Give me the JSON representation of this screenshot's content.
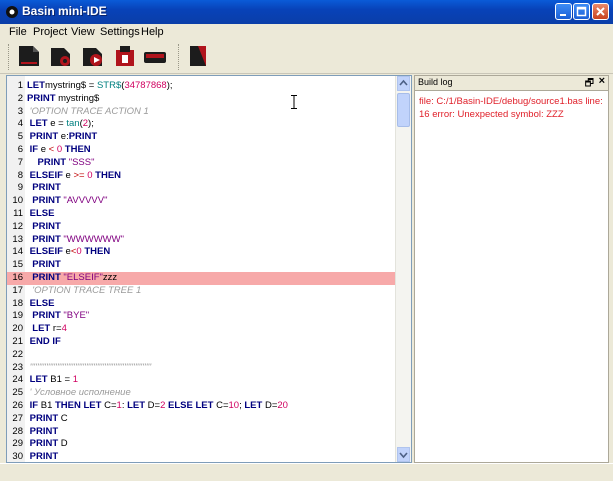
{
  "window": {
    "title": "Basin mini-IDE"
  },
  "menu": [
    "File",
    "Project",
    "View",
    "Settings",
    "Help"
  ],
  "toolbar": {
    "buttons": [
      {
        "name": "new-file-icon",
        "color": "#b0141c"
      },
      {
        "name": "open-project-icon",
        "color": "#b0141c"
      },
      {
        "name": "run-icon",
        "color": "#b0141c"
      },
      {
        "name": "build-icon",
        "color": "#b0141c"
      },
      {
        "name": "stop-icon",
        "color": "#b0141c"
      },
      {
        "name": "settings-icon",
        "color": "#b0141c"
      }
    ]
  },
  "editor": {
    "highlighted_line": 16,
    "lines": [
      {
        "n": "1",
        "t": [
          [
            "kw",
            "LET"
          ],
          [
            "",
            "mystring$ = "
          ],
          [
            "fn",
            "STR$"
          ],
          [
            "",
            "("
          ],
          [
            "num",
            "34787868"
          ],
          [
            "",
            ");"
          ]
        ]
      },
      {
        "n": "2",
        "t": [
          [
            "kw",
            "PRINT"
          ],
          [
            "",
            " mystring$"
          ]
        ]
      },
      {
        "n": "3",
        "t": [
          [
            "cmt",
            " 'OPTION TRACE ACTION 1"
          ]
        ]
      },
      {
        "n": "4",
        "t": [
          [
            "kw",
            " LET"
          ],
          [
            "",
            " e = "
          ],
          [
            "fn",
            "tan"
          ],
          [
            "",
            "("
          ],
          [
            "num",
            "2"
          ],
          [
            "",
            ");"
          ]
        ]
      },
      {
        "n": "5",
        "t": [
          [
            "kw",
            " PRINT"
          ],
          [
            "",
            " e:"
          ],
          [
            "kw",
            "PRINT"
          ]
        ]
      },
      {
        "n": "6",
        "t": [
          [
            "kw",
            " IF"
          ],
          [
            "",
            " e "
          ],
          [
            "op",
            "<"
          ],
          [
            "",
            " "
          ],
          [
            "num",
            "0"
          ],
          [
            "kw",
            " THEN"
          ]
        ]
      },
      {
        "n": "7",
        "t": [
          [
            "kw",
            "    PRINT"
          ],
          [
            "",
            " "
          ],
          [
            "str",
            "\"SSS\""
          ]
        ]
      },
      {
        "n": "8",
        "t": [
          [
            "kw",
            " ELSEIF"
          ],
          [
            "",
            " e "
          ],
          [
            "op",
            ">="
          ],
          [
            "",
            " "
          ],
          [
            "num",
            "0"
          ],
          [
            "kw",
            " THEN"
          ]
        ]
      },
      {
        "n": "9",
        "t": [
          [
            "kw",
            "  PRINT"
          ]
        ]
      },
      {
        "n": "10",
        "t": [
          [
            "kw",
            "  PRINT"
          ],
          [
            "",
            " "
          ],
          [
            "str",
            "\"AVVVVV\""
          ]
        ]
      },
      {
        "n": "11",
        "t": [
          [
            "kw",
            " ELSE"
          ]
        ]
      },
      {
        "n": "12",
        "t": [
          [
            "kw",
            "  PRINT"
          ]
        ]
      },
      {
        "n": "13",
        "t": [
          [
            "kw",
            "  PRINT"
          ],
          [
            "",
            " "
          ],
          [
            "str",
            "\"WWWWWW\""
          ]
        ]
      },
      {
        "n": "14",
        "t": [
          [
            "kw",
            " ELSEIF"
          ],
          [
            "",
            " e"
          ],
          [
            "op",
            "<"
          ],
          [
            "num",
            "0"
          ],
          [
            "kw",
            " THEN"
          ]
        ]
      },
      {
        "n": "15",
        "t": [
          [
            "kw",
            "  PRINT"
          ]
        ]
      },
      {
        "n": "16",
        "t": [
          [
            "kw",
            "  PRINT"
          ],
          [
            "",
            " "
          ],
          [
            "str",
            "\"ELSEIF\""
          ],
          [
            "",
            "zzz"
          ]
        ]
      },
      {
        "n": "17",
        "t": [
          [
            "cmt",
            "  'OPTION TRACE TREE 1"
          ]
        ]
      },
      {
        "n": "18",
        "t": [
          [
            "kw",
            " ELSE"
          ]
        ]
      },
      {
        "n": "19",
        "t": [
          [
            "kw",
            "  PRINT"
          ],
          [
            "",
            " "
          ],
          [
            "str",
            "\"BYE\""
          ]
        ]
      },
      {
        "n": "20",
        "t": [
          [
            "kw",
            "  LET"
          ],
          [
            "",
            " r="
          ],
          [
            "num",
            "4"
          ]
        ]
      },
      {
        "n": "21",
        "t": [
          [
            "kw",
            " END IF"
          ]
        ]
      },
      {
        "n": "22",
        "t": []
      },
      {
        "n": "23",
        "t": [
          [
            "cmt",
            " '''''''''''''''''''''''''''''''''''''''''''''''''''''''''''''''''''"
          ]
        ]
      },
      {
        "n": "24",
        "t": [
          [
            "kw",
            " LET"
          ],
          [
            "",
            " B1 = "
          ],
          [
            "num",
            "1"
          ]
        ]
      },
      {
        "n": "25",
        "t": [
          [
            "cmt",
            " ' Условное исполнение"
          ]
        ]
      },
      {
        "n": "26",
        "t": [
          [
            "kw",
            " IF"
          ],
          [
            "",
            " B1 "
          ],
          [
            "kw",
            "THEN LET"
          ],
          [
            "",
            " C="
          ],
          [
            "num",
            "1"
          ],
          [
            "",
            ": "
          ],
          [
            "kw",
            "LET"
          ],
          [
            "",
            " D="
          ],
          [
            "num",
            "2"
          ],
          [
            "kw",
            " ELSE LET"
          ],
          [
            "",
            " C="
          ],
          [
            "num",
            "10"
          ],
          [
            "",
            "; "
          ],
          [
            "kw",
            "LET"
          ],
          [
            "",
            " D="
          ],
          [
            "num",
            "20"
          ]
        ]
      },
      {
        "n": "27",
        "t": [
          [
            "kw",
            " PRINT"
          ],
          [
            "",
            " C"
          ]
        ]
      },
      {
        "n": "28",
        "t": [
          [
            "kw",
            " PRINT"
          ]
        ]
      },
      {
        "n": "29",
        "t": [
          [
            "kw",
            " PRINT"
          ],
          [
            "",
            " D"
          ]
        ]
      },
      {
        "n": "30",
        "t": [
          [
            "kw",
            " PRINT"
          ]
        ]
      }
    ]
  },
  "build_log": {
    "title": "Build log",
    "message": "file: C:/1/Basin-IDE/debug/source1.bas line: 16 error: Unexpected symbol: ZZZ"
  }
}
